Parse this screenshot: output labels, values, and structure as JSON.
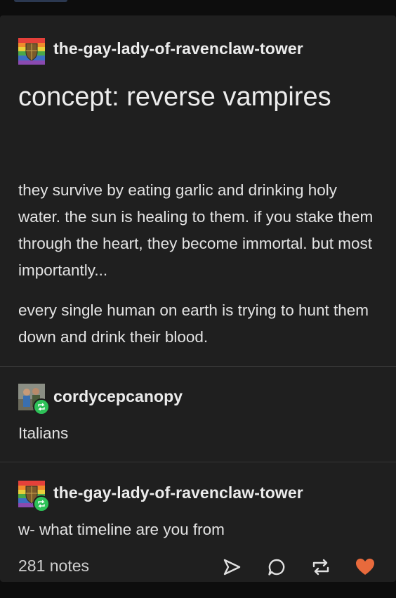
{
  "post": {
    "author": "the-gay-lady-of-ravenclaw-tower",
    "title": "concept: reverse vampires",
    "paragraphs": [
      "they survive by eating garlic and drinking holy water. the sun is healing to them. if you stake them through the heart, they become immortal. but most importantly...",
      "every single human on earth is trying to hunt them down and drink their blood."
    ]
  },
  "reblogs": [
    {
      "author": "cordycepcanopy",
      "text": "Italians"
    },
    {
      "author": "the-gay-lady-of-ravenclaw-tower",
      "text": "w- what timeline are you from"
    }
  ],
  "footer": {
    "notes": "281 notes"
  },
  "icons": {
    "share": "send-arrow-icon",
    "reply": "speech-bubble-icon",
    "reblog": "reblog-arrows-icon",
    "like": "heart-icon"
  },
  "colors": {
    "like": "#e86a3c",
    "reblog_badge": "#2ec158",
    "card_background": "#1f1f1f"
  }
}
